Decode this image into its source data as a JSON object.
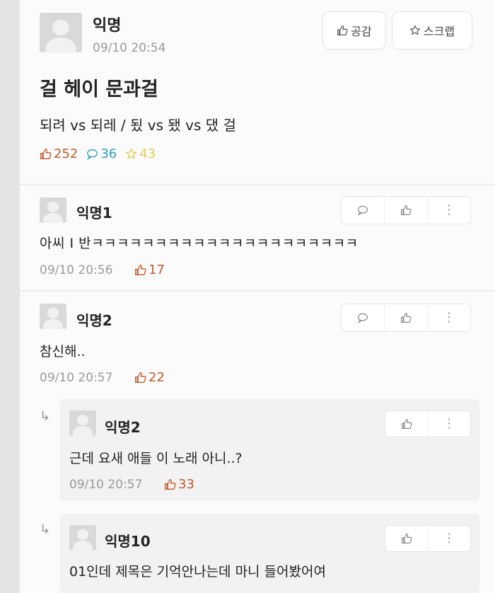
{
  "post": {
    "author": "익명",
    "time": "09/10 20:54",
    "title": "걸 헤이 문과걸",
    "body": "되려 vs 되레 / 됬 vs 됐 vs 댔 걸",
    "likes": "252",
    "comments": "36",
    "scraps": "43",
    "like_button": "공감",
    "scrap_button": "스크랩"
  },
  "comments": [
    {
      "author": "익명1",
      "text": "아씨 I 반ㅋㅋㅋㅋㅋㅋㅋㅋㅋㅋㅋㅋㅋㅋㅋㅋㅋㅋㅋㅋㅋ",
      "time": "09/10 20:56",
      "likes": "17"
    },
    {
      "author": "익명2",
      "text": "참신해..",
      "time": "09/10 20:57",
      "likes": "22"
    }
  ],
  "replies": [
    {
      "author": "익명2",
      "text": "근데 요새 애들 이 노래 아니..?",
      "time": "09/10 20:57",
      "likes": "33"
    },
    {
      "author": "익명10",
      "text": "01인데 제목은 기억안나는데 마니 들어봤어여"
    }
  ],
  "colors": {
    "like": "#c25b2c",
    "comment": "#2f9fc0",
    "scrap": "#e7cc52"
  }
}
